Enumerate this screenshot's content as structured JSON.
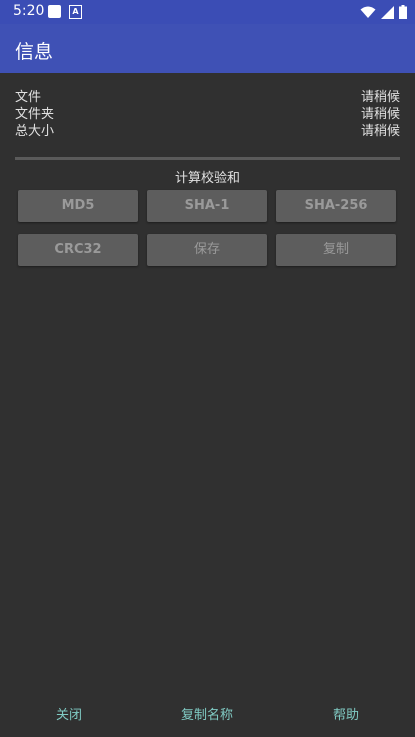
{
  "status_bar": {
    "time": "5:20"
  },
  "app_bar": {
    "title": "信息"
  },
  "info": {
    "rows": [
      {
        "label": "文件",
        "value": "请稍候"
      },
      {
        "label": "文件夹",
        "value": "请稍候"
      },
      {
        "label": "总大小",
        "value": "请稍候"
      }
    ]
  },
  "checksum": {
    "title": "计算校验和",
    "buttons": {
      "md5": "MD5",
      "sha1": "SHA-1",
      "sha256": "SHA-256",
      "crc32": "CRC32",
      "save": "保存",
      "copy": "复制"
    }
  },
  "bottom": {
    "close": "关闭",
    "copy_name": "复制名称",
    "help": "帮助"
  },
  "colors": {
    "app_bar": "#3f51b5",
    "status_bar": "#3b4db5",
    "background": "#303030",
    "accent": "#80cbc4"
  }
}
